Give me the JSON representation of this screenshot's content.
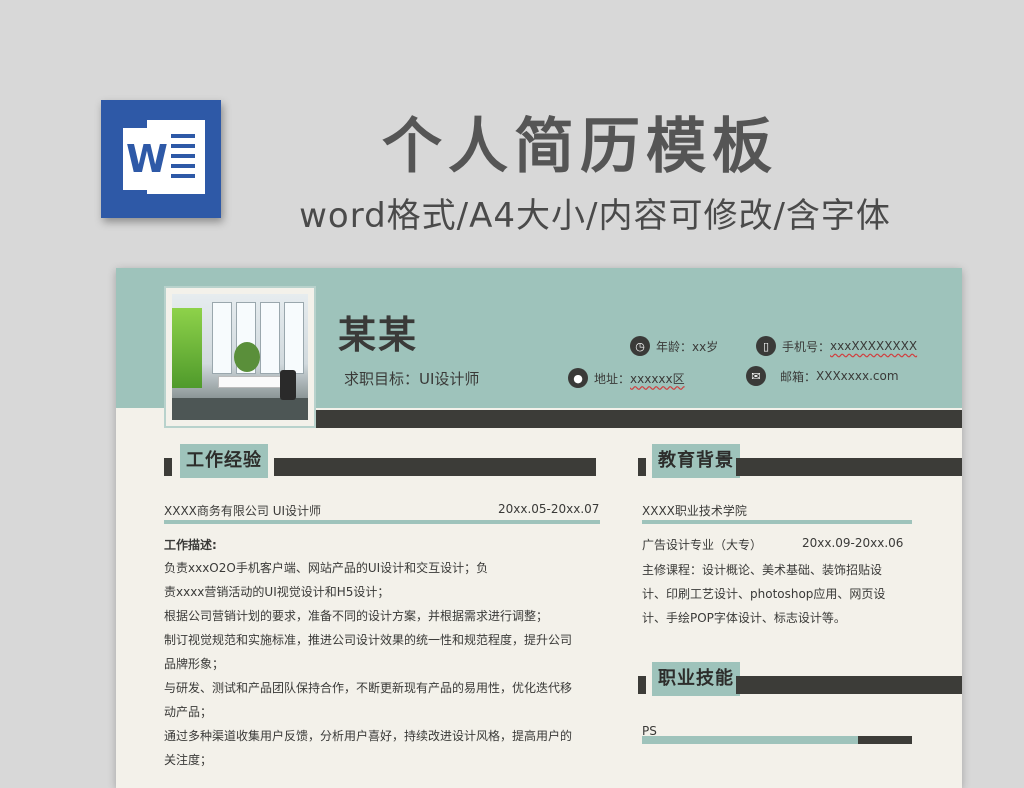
{
  "banner": {
    "title": "个人简历模板",
    "subtitle": "word格式/A4大小/内容可修改/含字体",
    "word_icon_letter": "W"
  },
  "profile": {
    "name": "某某",
    "job_label": "求职目标：UI设计师",
    "age_label": "年龄：",
    "age_value": "xx岁",
    "phone_label": "手机号：",
    "phone_value": "xxxXXXXXXXX",
    "address_label": "地址：",
    "address_value": "xxxxxx区",
    "email_label": "邮箱：",
    "email_value": "XXXxxxx.com"
  },
  "work": {
    "section_title": "工作经验",
    "company": "XXXX商务有限公司  UI设计师",
    "period": "20xx.05-20xx.07",
    "desc_title": "工作描述:",
    "lines": [
      "负责xxxO2O手机客户端、网站产品的UI设计和交互设计；负",
      "责xxxx营销活动的UI视觉设计和H5设计；",
      "根据公司营销计划的要求，准备不同的设计方案，并根据需求进行调整；",
      "制订视觉规范和实施标准，推进公司设计效果的统一性和规范程度，提升公司",
      "品牌形象；",
      "与研发、测试和产品团队保持合作，不断更新现有产品的易用性，优化迭代移",
      "动产品；",
      "通过多种渠道收集用户反馈，分析用户喜好，持续改进设计风格，提高用户的",
      "关注度；"
    ]
  },
  "education": {
    "section_title": "教育背景",
    "school": "XXXX职业技术学院",
    "major": "广告设计专业（大专）",
    "period": "20xx.09-20xx.06",
    "lines": [
      "主修课程：设计概论、美术基础、装饰招贴设",
      "计、印刷工艺设计、photoshop应用、网页设",
      "计、手绘POP字体设计、标志设计等。"
    ]
  },
  "skills": {
    "section_title": "职业技能",
    "items": [
      {
        "name": "PS",
        "level": 0.8
      }
    ]
  },
  "colors": {
    "accent": "#9ec3bb",
    "dark": "#3c3c38",
    "paper": "#f3f1ea",
    "word_blue": "#2e59a7"
  }
}
